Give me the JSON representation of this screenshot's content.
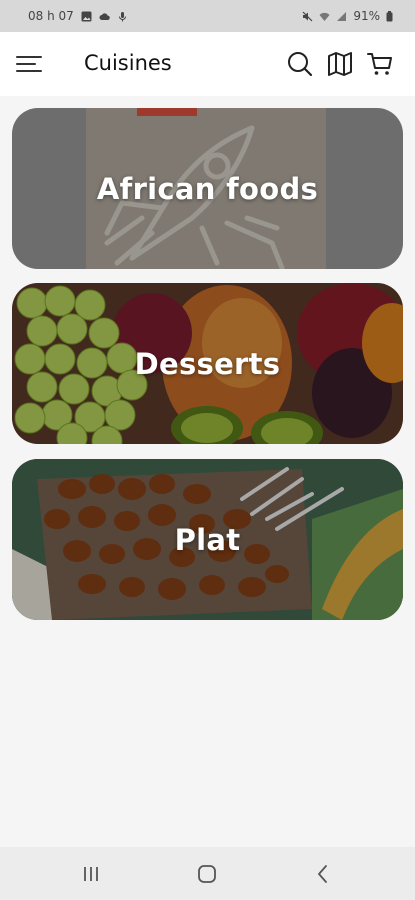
{
  "status_bar": {
    "time": "08 h 07",
    "battery": "91%"
  },
  "app_bar": {
    "title": "Cuisines",
    "icons": [
      "menu-icon",
      "search-icon",
      "map-icon",
      "cart-icon"
    ]
  },
  "categories": [
    {
      "label": "African foods"
    },
    {
      "label": "Desserts"
    },
    {
      "label": "Plat"
    }
  ],
  "nav_bar": {
    "icons": [
      "recents-icon",
      "home-icon",
      "back-icon"
    ]
  },
  "colors": {
    "app_bar": "#ffffff",
    "background": "#f5f5f5",
    "status_bar": "#d8d8d8"
  }
}
